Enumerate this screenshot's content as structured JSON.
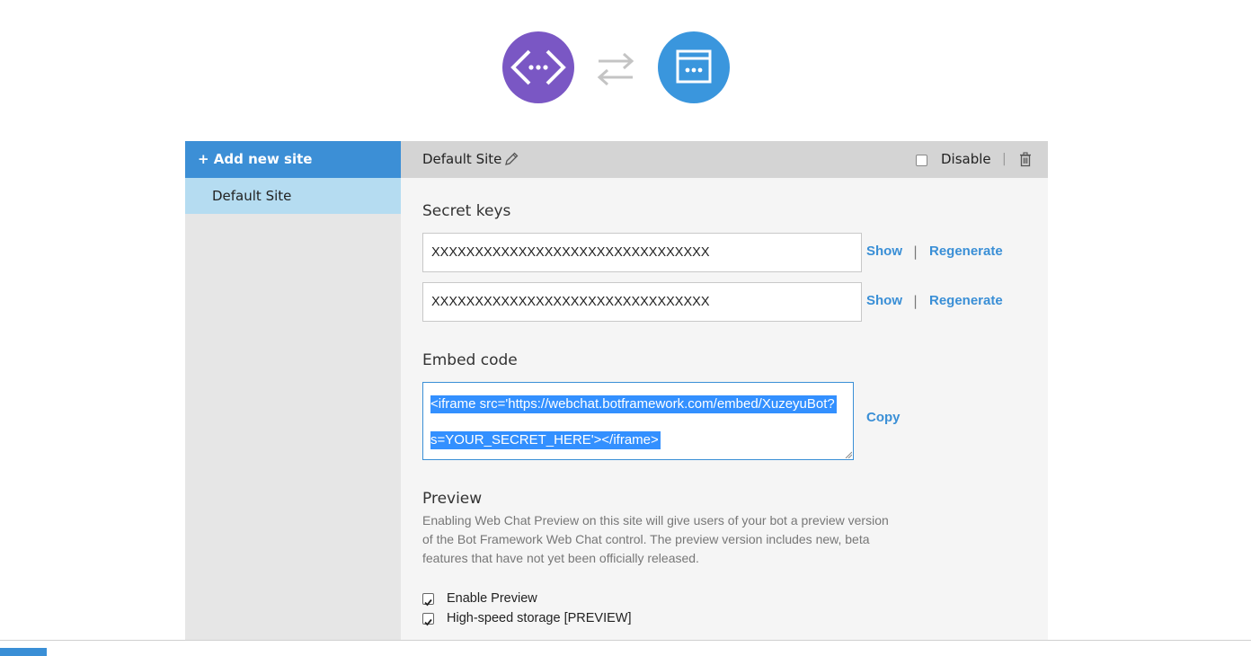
{
  "header": {
    "bot_icon": "code-brackets-icon",
    "sync_icon": "swap-arrows-icon",
    "webchat_icon": "browser-window-icon",
    "colors": {
      "bot": "#7a57c4",
      "webchat": "#3a96dd"
    }
  },
  "sidebar": {
    "add_label": "+ Add new site",
    "sites": [
      {
        "label": "Default Site",
        "selected": true
      }
    ]
  },
  "site": {
    "name": "Default Site",
    "disable_label": "Disable",
    "disabled": false,
    "separator": "|"
  },
  "secret_keys": {
    "title": "Secret keys",
    "keys": [
      {
        "value": "XXXXXXXXXXXXXXXXXXXXXXXXXXXXXXXX",
        "show_label": "Show",
        "separator": "|",
        "regenerate_label": "Regenerate"
      },
      {
        "value": "XXXXXXXXXXXXXXXXXXXXXXXXXXXXXXXX",
        "show_label": "Show",
        "separator": "|",
        "regenerate_label": "Regenerate"
      }
    ]
  },
  "embed": {
    "title": "Embed code",
    "line1": "<iframe src='https://webchat.botframework.com/embed/XuzeyuBot?",
    "line2": "s=YOUR_SECRET_HERE'></iframe>",
    "copy_label": "Copy"
  },
  "preview": {
    "title": "Preview",
    "description": "Enabling Web Chat Preview on this site will give users of your bot a preview version of the Bot Framework Web Chat control. The preview version includes new, beta features that have not yet been officially released.",
    "options": [
      {
        "label": "Enable Preview",
        "checked": true
      },
      {
        "label": "High-speed storage [PREVIEW]",
        "checked": true
      }
    ]
  },
  "accent_color": "#3a8fd6"
}
